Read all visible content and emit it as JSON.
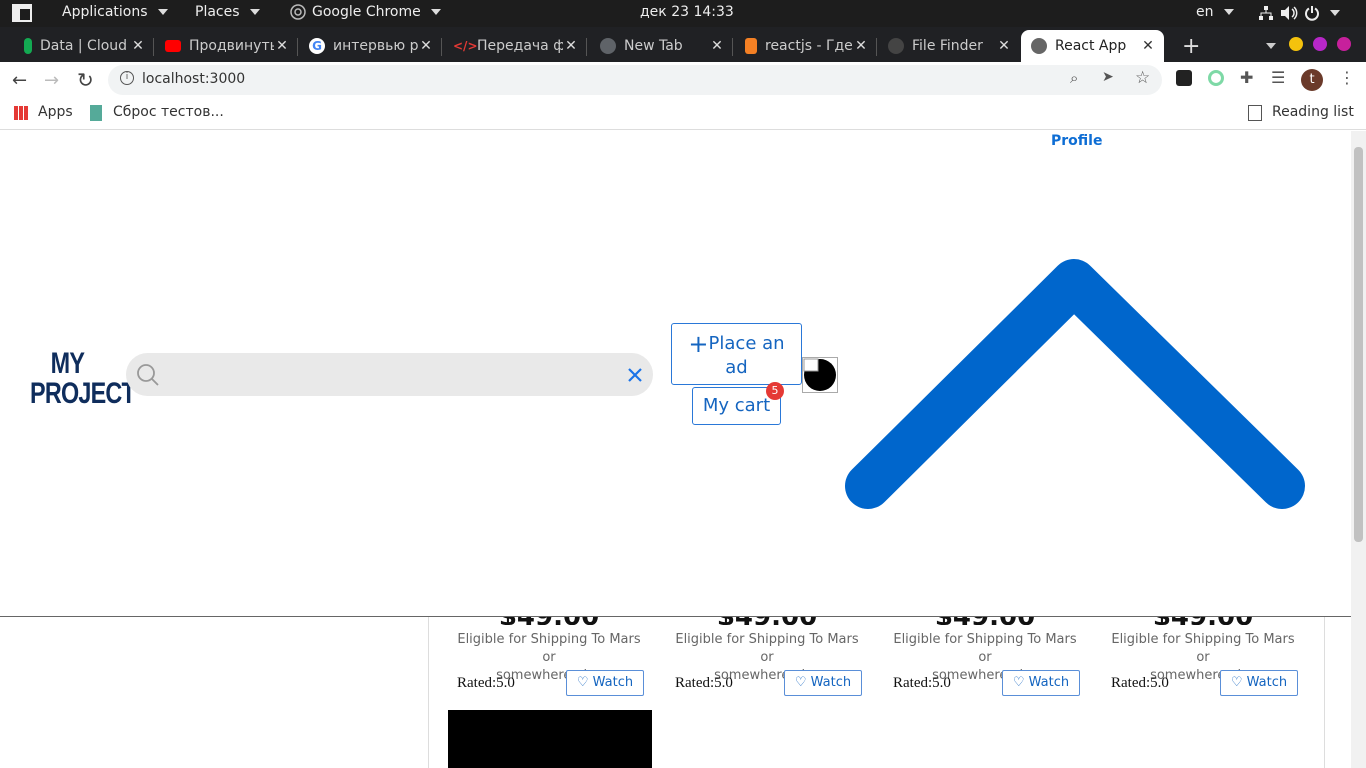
{
  "system_bar": {
    "applications": "Applications",
    "places": "Places",
    "browser": "Google Chrome",
    "datetime": "дек 23  14:33",
    "lang": "en"
  },
  "tabs": [
    {
      "title": "Data | Cloud",
      "favicon_color": "#13aa52"
    },
    {
      "title": "Продвинутый",
      "favicon_color": "#ff0000"
    },
    {
      "title": "интервью р",
      "favicon_color": "#4285f4"
    },
    {
      "title": "Передача ф",
      "favicon_color": "#e53935"
    },
    {
      "title": "New Tab",
      "favicon_color": "#777"
    },
    {
      "title": "reactjs - Где",
      "favicon_color": "#f48024"
    },
    {
      "title": "File Finder",
      "favicon_color": "#333"
    },
    {
      "title": "React App",
      "favicon_color": "#555"
    }
  ],
  "address": {
    "url": "localhost:3000"
  },
  "bookmarks": {
    "apps": "Apps",
    "item1": "Сброс тестов...",
    "reading_list": "Reading list"
  },
  "profile_avatar_letter": "t",
  "page": {
    "profile_link": "Profile",
    "logo_line1": "MY",
    "logo_line2": "PROJECT",
    "place_ad_line1": "Place an",
    "place_ad_line2": "ad",
    "cart_label": "My cart",
    "cart_count": "5",
    "accent_color": "#0066cc"
  },
  "products": [
    {
      "price": "$49.00",
      "eligible_line1": "Eligible for Shipping To Mars or",
      "eligible_line2": "somewhere else",
      "rated": "Rated:5.0",
      "watch": "Watch"
    },
    {
      "price": "$49.00",
      "eligible_line1": "Eligible for Shipping To Mars or",
      "eligible_line2": "somewhere else",
      "rated": "Rated:5.0",
      "watch": "Watch"
    },
    {
      "price": "$49.00",
      "eligible_line1": "Eligible for Shipping To Mars or",
      "eligible_line2": "somewhere else",
      "rated": "Rated:5.0",
      "watch": "Watch"
    },
    {
      "price": "$49.00",
      "eligible_line1": "Eligible for Shipping To Mars or",
      "eligible_line2": "somewhere else",
      "rated": "Rated:5.0",
      "watch": "Watch"
    }
  ]
}
